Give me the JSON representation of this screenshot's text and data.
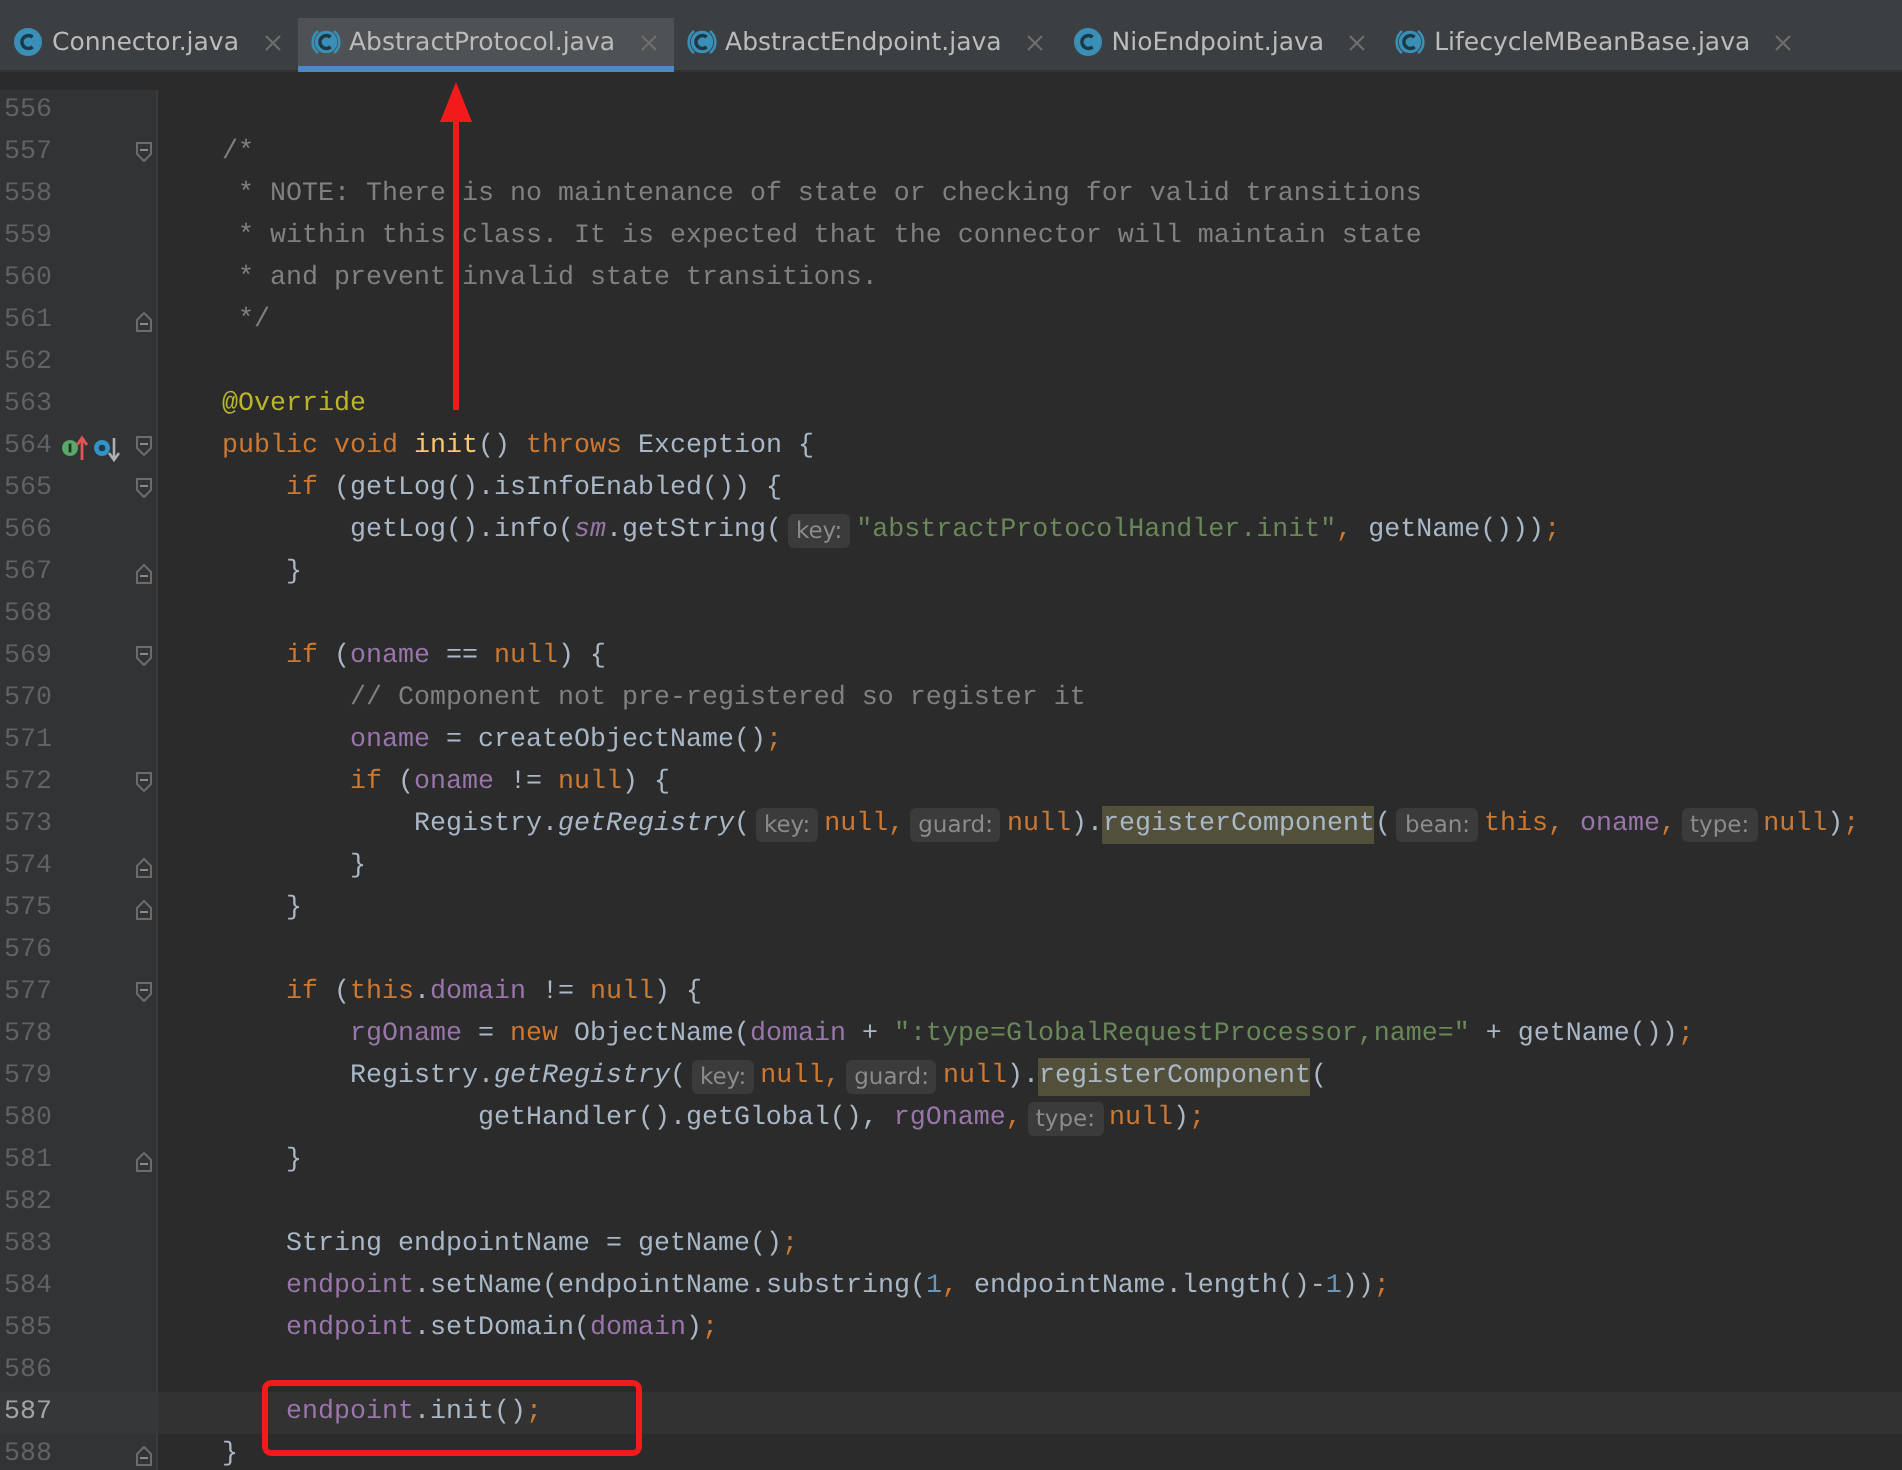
{
  "tabs": [
    {
      "label": "Connector.java",
      "kind": "class",
      "selected": false
    },
    {
      "label": "AbstractProtocol.java",
      "kind": "abstract-class",
      "selected": true
    },
    {
      "label": "AbstractEndpoint.java",
      "kind": "abstract-class",
      "selected": false
    },
    {
      "label": "NioEndpoint.java",
      "kind": "class",
      "selected": false
    },
    {
      "label": "LifecycleMBeanBase.java",
      "kind": "abstract-class",
      "selected": false
    }
  ],
  "lines": [
    {
      "number": "556"
    },
    {
      "number": "557",
      "fold_start": true,
      "tokens": [
        {
          "text": "    /*",
          "kind": "comment"
        }
      ]
    },
    {
      "number": "558",
      "tokens": [
        {
          "text": "     * NOTE: There is no maintenance of state or checking for valid transitions",
          "kind": "comment"
        }
      ]
    },
    {
      "number": "559",
      "tokens": [
        {
          "text": "     * within this class. It is expected that the connector will maintain state",
          "kind": "comment"
        }
      ]
    },
    {
      "number": "560",
      "tokens": [
        {
          "text": "     * and prevent invalid state transitions.",
          "kind": "comment"
        }
      ]
    },
    {
      "number": "561",
      "fold_end": true,
      "tokens": [
        {
          "text": "     */",
          "kind": "comment"
        }
      ]
    },
    {
      "number": "562"
    },
    {
      "number": "563",
      "tokens": [
        {
          "text": "    @Override",
          "kind": "annotation"
        }
      ]
    },
    {
      "number": "564",
      "fold_start": true,
      "gutter_icons": [
        {
          "kind": "implements"
        },
        {
          "kind": "overridden"
        }
      ],
      "tokens": [
        {
          "text": "    public void ",
          "kind": "keyword"
        },
        {
          "text": "init",
          "kind": "declaration"
        },
        {
          "text": "() ",
          "kind": "plain"
        },
        {
          "text": "throws ",
          "kind": "keyword"
        },
        {
          "text": "Exception {",
          "kind": "plain"
        }
      ]
    },
    {
      "number": "565",
      "fold_start": true,
      "tokens": [
        {
          "text": "        if ",
          "kind": "keyword"
        },
        {
          "text": "(getLog().isInfoEnabled()) {",
          "kind": "plain"
        }
      ]
    },
    {
      "number": "566",
      "tokens": [
        {
          "text": "            getLog().info(",
          "kind": "plain"
        },
        {
          "text": "sm",
          "kind": "static-field"
        },
        {
          "text": ".getString(",
          "kind": "plain"
        },
        {
          "text": "key:",
          "kind": "hint"
        },
        {
          "text": "\"abstractProtocolHandler.init\"",
          "kind": "string"
        },
        {
          "text": ",",
          "kind": "keyword"
        },
        {
          "text": " getName()))",
          "kind": "plain"
        },
        {
          "text": ";",
          "kind": "keyword"
        }
      ]
    },
    {
      "number": "567",
      "fold_end": true,
      "tokens": [
        {
          "text": "        }",
          "kind": "plain"
        }
      ]
    },
    {
      "number": "568"
    },
    {
      "number": "569",
      "fold_start": true,
      "tokens": [
        {
          "text": "        if ",
          "kind": "keyword"
        },
        {
          "text": "(",
          "kind": "plain"
        },
        {
          "text": "oname",
          "kind": "field"
        },
        {
          "text": " == ",
          "kind": "plain"
        },
        {
          "text": "null",
          "kind": "keyword"
        },
        {
          "text": ") {",
          "kind": "plain"
        }
      ]
    },
    {
      "number": "570",
      "tokens": [
        {
          "text": "            // Component not pre-registered so register it",
          "kind": "comment"
        }
      ]
    },
    {
      "number": "571",
      "tokens": [
        {
          "text": "            oname",
          "kind": "field"
        },
        {
          "text": " = createObjectName()",
          "kind": "plain"
        },
        {
          "text": ";",
          "kind": "keyword"
        }
      ]
    },
    {
      "number": "572",
      "fold_start": true,
      "tokens": [
        {
          "text": "            if ",
          "kind": "keyword"
        },
        {
          "text": "(",
          "kind": "plain"
        },
        {
          "text": "oname",
          "kind": "field"
        },
        {
          "text": " != ",
          "kind": "plain"
        },
        {
          "text": "null",
          "kind": "keyword"
        },
        {
          "text": ") {",
          "kind": "plain"
        }
      ]
    },
    {
      "number": "573",
      "tokens": [
        {
          "text": "                Registry.",
          "kind": "plain"
        },
        {
          "text": "getRegistry",
          "kind": "static-method"
        },
        {
          "text": "(",
          "kind": "plain"
        },
        {
          "text": "key:",
          "kind": "hint"
        },
        {
          "text": "null,",
          "kind": "keyword"
        },
        {
          "text": "guard:",
          "kind": "hint"
        },
        {
          "text": "null",
          "kind": "keyword"
        },
        {
          "text": ").",
          "kind": "plain"
        },
        {
          "text": "registerComponent",
          "kind": "highlight"
        },
        {
          "text": "(",
          "kind": "plain"
        },
        {
          "text": "bean:",
          "kind": "hint"
        },
        {
          "text": "this,",
          "kind": "keyword"
        },
        {
          "text": " oname",
          "kind": "field"
        },
        {
          "text": ",",
          "kind": "keyword"
        },
        {
          "text": "type:",
          "kind": "hint"
        },
        {
          "text": "null",
          "kind": "keyword"
        },
        {
          "text": ")",
          "kind": "plain"
        },
        {
          "text": ";",
          "kind": "keyword"
        }
      ]
    },
    {
      "number": "574",
      "fold_end": true,
      "tokens": [
        {
          "text": "            }",
          "kind": "plain"
        }
      ]
    },
    {
      "number": "575",
      "fold_end": true,
      "tokens": [
        {
          "text": "        }",
          "kind": "plain"
        }
      ]
    },
    {
      "number": "576"
    },
    {
      "number": "577",
      "fold_start": true,
      "tokens": [
        {
          "text": "        if ",
          "kind": "keyword"
        },
        {
          "text": "(",
          "kind": "plain"
        },
        {
          "text": "this",
          "kind": "keyword"
        },
        {
          "text": ".",
          "kind": "plain"
        },
        {
          "text": "domain",
          "kind": "field"
        },
        {
          "text": " != ",
          "kind": "plain"
        },
        {
          "text": "null",
          "kind": "keyword"
        },
        {
          "text": ") {",
          "kind": "plain"
        }
      ]
    },
    {
      "number": "578",
      "tokens": [
        {
          "text": "            rgOname",
          "kind": "field"
        },
        {
          "text": " = ",
          "kind": "plain"
        },
        {
          "text": "new ",
          "kind": "keyword"
        },
        {
          "text": "ObjectName(",
          "kind": "plain"
        },
        {
          "text": "domain",
          "kind": "field"
        },
        {
          "text": " + ",
          "kind": "plain"
        },
        {
          "text": "\":type=GlobalRequestProcessor,name=\"",
          "kind": "string"
        },
        {
          "text": " + getName())",
          "kind": "plain"
        },
        {
          "text": ";",
          "kind": "keyword"
        }
      ]
    },
    {
      "number": "579",
      "tokens": [
        {
          "text": "            Registry.",
          "kind": "plain"
        },
        {
          "text": "getRegistry",
          "kind": "static-method"
        },
        {
          "text": "(",
          "kind": "plain"
        },
        {
          "text": "key:",
          "kind": "hint"
        },
        {
          "text": "null,",
          "kind": "keyword"
        },
        {
          "text": "guard:",
          "kind": "hint"
        },
        {
          "text": "null",
          "kind": "keyword"
        },
        {
          "text": ").",
          "kind": "plain"
        },
        {
          "text": "registerComponent",
          "kind": "highlight"
        },
        {
          "text": "(",
          "kind": "plain"
        }
      ]
    },
    {
      "number": "580",
      "tokens": [
        {
          "text": "                    getHandler().getGlobal(), ",
          "kind": "plain"
        },
        {
          "text": "rgOname",
          "kind": "field"
        },
        {
          "text": ",",
          "kind": "keyword"
        },
        {
          "text": "type:",
          "kind": "hint"
        },
        {
          "text": "null",
          "kind": "keyword"
        },
        {
          "text": ")",
          "kind": "plain"
        },
        {
          "text": ";",
          "kind": "keyword"
        }
      ]
    },
    {
      "number": "581",
      "fold_end": true,
      "tokens": [
        {
          "text": "        }",
          "kind": "plain"
        }
      ]
    },
    {
      "number": "582"
    },
    {
      "number": "583",
      "tokens": [
        {
          "text": "        String endpointName = getName()",
          "kind": "plain"
        },
        {
          "text": ";",
          "kind": "keyword"
        }
      ]
    },
    {
      "number": "584",
      "tokens": [
        {
          "text": "        endpoint",
          "kind": "field"
        },
        {
          "text": ".setName(endpointName.substring(",
          "kind": "plain"
        },
        {
          "text": "1",
          "kind": "number"
        },
        {
          "text": ", ",
          "kind": "keyword"
        },
        {
          "text": "endpointName.length()-",
          "kind": "plain"
        },
        {
          "text": "1",
          "kind": "number"
        },
        {
          "text": "))",
          "kind": "plain"
        },
        {
          "text": ";",
          "kind": "keyword"
        }
      ]
    },
    {
      "number": "585",
      "tokens": [
        {
          "text": "        endpoint",
          "kind": "field"
        },
        {
          "text": ".setDomain(",
          "kind": "plain"
        },
        {
          "text": "domain",
          "kind": "field"
        },
        {
          "text": ")",
          "kind": "plain"
        },
        {
          "text": ";",
          "kind": "keyword"
        }
      ]
    },
    {
      "number": "586"
    },
    {
      "number": "587",
      "current": true,
      "tokens": [
        {
          "text": "        endpoint",
          "kind": "field"
        },
        {
          "text": ".init()",
          "kind": "plain"
        },
        {
          "text": ";",
          "kind": "keyword"
        }
      ]
    },
    {
      "number": "588",
      "fold_end": true,
      "tokens": [
        {
          "text": "    }",
          "kind": "plain"
        }
      ]
    }
  ]
}
